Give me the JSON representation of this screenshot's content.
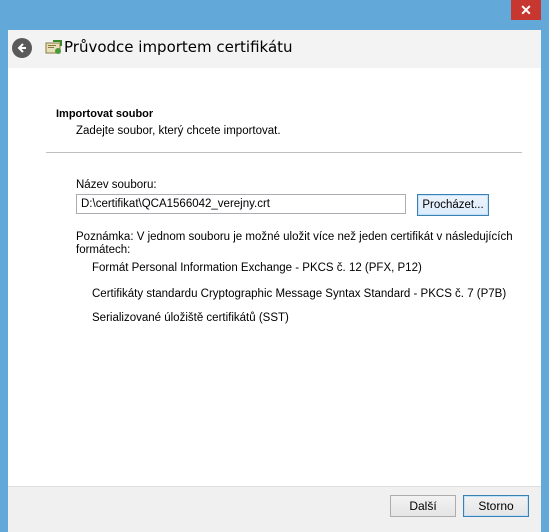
{
  "window": {
    "close_label": "✕"
  },
  "wizard": {
    "title": "Průvodce importem certifikátu"
  },
  "section": {
    "heading": "Importovat soubor",
    "subheading": "Zadejte soubor, který chcete importovat."
  },
  "file": {
    "label": "Název souboru:",
    "value": "D:\\certifikat\\QCA1566042_verejny.crt",
    "browse_label": "Procházet..."
  },
  "note": {
    "text": "Poznámka: V jednom souboru je možné uložit více než jeden certifikát v následujících formátech:",
    "formats": [
      "Formát Personal Information Exchange - PKCS č. 12 (PFX, P12)",
      "Certifikáty standardu Cryptographic Message Syntax Standard - PKCS č. 7 (P7B)",
      "Serializované úložiště certifikátů (SST)"
    ]
  },
  "footer": {
    "next_label": "Další",
    "cancel_label": "Storno"
  }
}
